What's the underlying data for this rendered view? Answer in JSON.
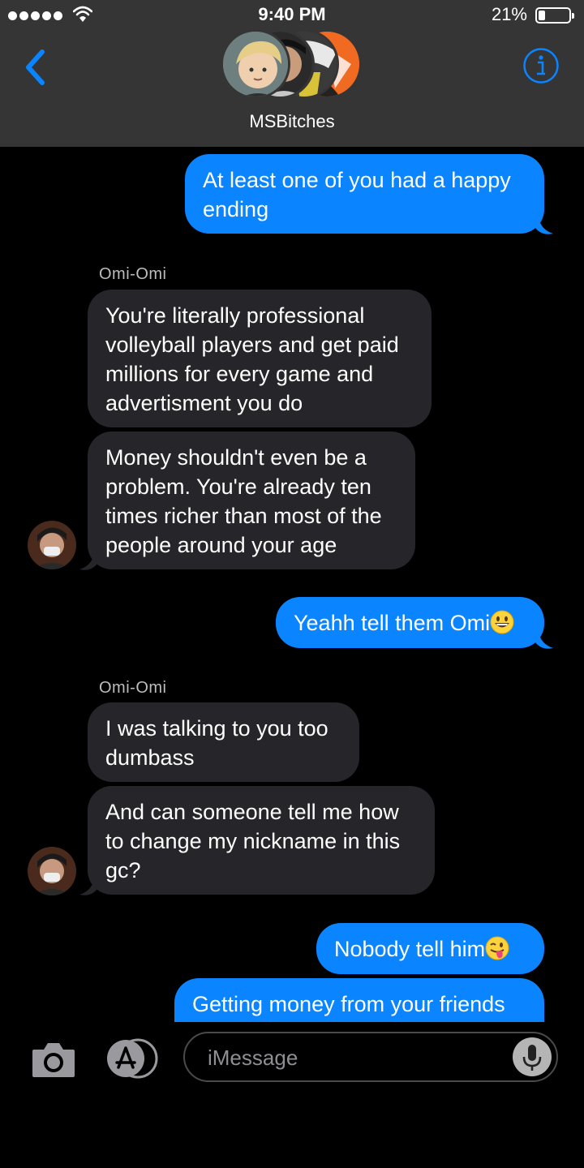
{
  "status_bar": {
    "time": "9:40 PM",
    "battery_percent": "21%",
    "battery_level": 0.21,
    "signal_dots": 5
  },
  "header": {
    "group_name": "MSBitches",
    "back_icon": "chevron-left-icon",
    "info_icon": "info-icon"
  },
  "messages": [
    {
      "direction": "sent",
      "lines": [
        "At least one of you had a happy",
        "ending"
      ]
    },
    {
      "direction": "received",
      "sender": "Omi-Omi",
      "lines": [
        "You're literally professional",
        "volleyball players and get paid",
        "millions for every game and",
        "advertisment you do"
      ]
    },
    {
      "direction": "received",
      "lines": [
        "Money shouldn't even be a",
        "problem. You're already ten",
        "times richer than most of the",
        "people around your age"
      ]
    },
    {
      "direction": "sent",
      "text": "Yeahh tell them Omi",
      "emoji": "grinning-face-emoji"
    },
    {
      "direction": "received",
      "sender": "Omi-Omi",
      "lines": [
        "I was talking to you too",
        "dumbass"
      ]
    },
    {
      "direction": "received",
      "lines": [
        "And can someone tell me how",
        "to change my nickname in this",
        "gc?"
      ]
    },
    {
      "direction": "sent",
      "text": "Nobody tell him",
      "emoji": "tongue-out-emoji"
    },
    {
      "direction": "sent",
      "lines": [
        "Getting money from your friends"
      ]
    }
  ],
  "input": {
    "placeholder": "iMessage"
  },
  "colors": {
    "sent_bubble": "#0a84ff",
    "received_bubble": "#262529",
    "header_bg": "#353535",
    "accent": "#0a84ff"
  }
}
